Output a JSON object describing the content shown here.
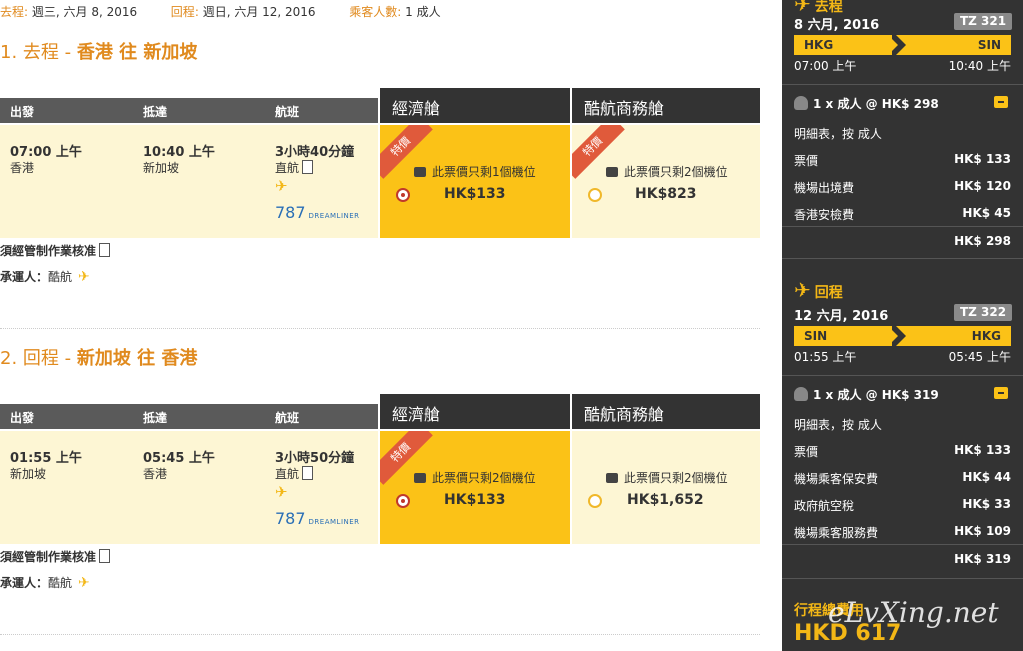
{
  "summary": {
    "outbound_label": "去程",
    "outbound_value": "週三, 六月 8, 2016",
    "return_label": "回程",
    "return_value": "週日, 六月 12, 2016",
    "pax_label": "乘客人數",
    "pax_value": "1 成人"
  },
  "table_headers": {
    "depart": "出發",
    "arrive": "抵達",
    "flight": "航班",
    "economy": "經濟艙",
    "business": "酷航商務艙"
  },
  "sections": [
    {
      "num": "1.",
      "label": "去程",
      "route": "香港 往 新加坡",
      "dep_time": "07:00 上午",
      "dep_city": "香港",
      "arr_time": "10:40 上午",
      "arr_city": "新加坡",
      "duration": "3小時40分鐘",
      "nonstop": "直航",
      "aircraft": "787",
      "aircraft_sub": "DREAMLINER",
      "promo": "特價",
      "eco_seats": "此票價只剩1個機位",
      "eco_price": "HK$133",
      "biz_seats": "此票價只剩2個機位",
      "biz_price": "HK$823",
      "approval": "須經管制作業核准",
      "carrier_label": "承運人：",
      "carrier": "酷航"
    },
    {
      "num": "2.",
      "label": "回程",
      "route": "新加坡 往 香港",
      "dep_time": "01:55 上午",
      "dep_city": "新加坡",
      "arr_time": "05:45 上午",
      "arr_city": "香港",
      "duration": "3小時50分鐘",
      "nonstop": "直航",
      "aircraft": "787",
      "aircraft_sub": "DREAMLINER",
      "promo": "特價",
      "eco_seats": "此票價只剩2個機位",
      "eco_price": "HK$133",
      "biz_seats": "此票價只剩2個機位",
      "biz_price": "HK$1,652",
      "approval": "須經管制作業核准",
      "carrier_label": "承運人：",
      "carrier": "酷航"
    }
  ],
  "sidebar": {
    "outbound": {
      "title": "去程",
      "date": "8 六月, 2016",
      "flight": "TZ 321",
      "from": "HKG",
      "to": "SIN",
      "dep": "07:00 上午",
      "arr": "10:40 上午",
      "pax": "1 x 成人 @ HK$ 298",
      "breakdown_label": "明細表，按 成人",
      "lines": [
        {
          "label": "票價",
          "amount": "HK$ 133"
        },
        {
          "label": "機場出境費",
          "amount": "HK$ 120"
        },
        {
          "label": "香港安檢費",
          "amount": "HK$ 45"
        }
      ],
      "subtotal": "HK$ 298"
    },
    "return": {
      "title": "回程",
      "date": "12 六月, 2016",
      "flight": "TZ 322",
      "from": "SIN",
      "to": "HKG",
      "dep": "01:55 上午",
      "arr": "05:45 上午",
      "pax": "1 x 成人 @ HK$ 319",
      "breakdown_label": "明細表，按 成人",
      "lines": [
        {
          "label": "票價",
          "amount": "HK$ 133"
        },
        {
          "label": "機場乘客保安費",
          "amount": "HK$ 44"
        },
        {
          "label": "政府航空稅",
          "amount": "HK$ 33"
        },
        {
          "label": "機場乘客服務費",
          "amount": "HK$ 109"
        }
      ],
      "subtotal": "HK$ 319"
    },
    "total_label": "行程總費用",
    "total": "HKD 617"
  },
  "watermark": "eLvXing.net",
  "colors": {
    "accent": "#e08a1e",
    "yellow": "#fbc217",
    "dark": "#333333",
    "promo": "#e05a3b",
    "cream": "#fdf6d4"
  }
}
